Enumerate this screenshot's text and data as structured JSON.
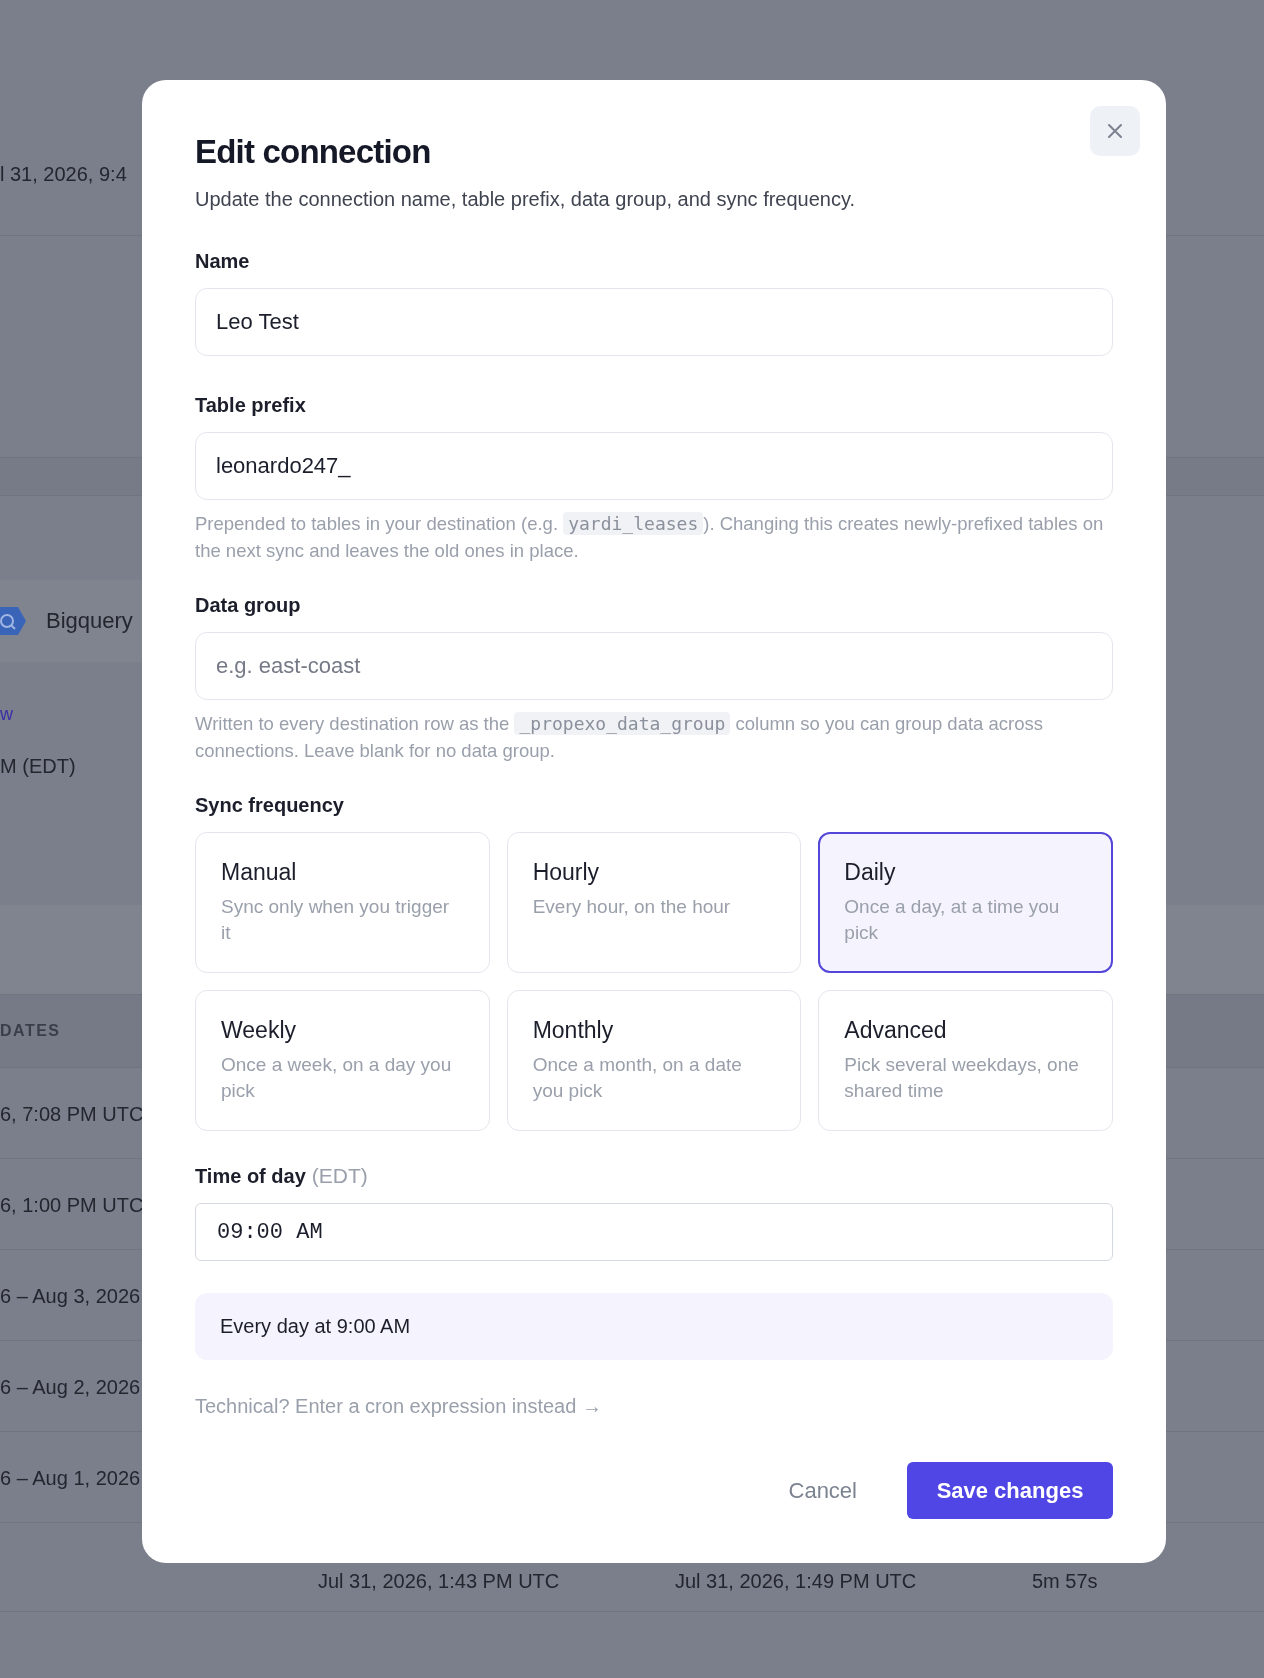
{
  "background": {
    "top_date": "l 31, 2026, 9:4",
    "destination": "Bigquery",
    "link_fragment": "w",
    "schedule_fragment": "M (EDT)",
    "table": {
      "column_header": "DATES",
      "rows": [
        "6, 7:08 PM UTC",
        "6, 1:00 PM UTC",
        "6 – Aug 3, 2026",
        "6 – Aug 2, 2026",
        "6 – Aug 1, 2026"
      ],
      "bottom_row": [
        "Jul 31, 2026, 1:43 PM UTC",
        "Jul 31, 2026, 1:49 PM UTC",
        "5m 57s"
      ]
    }
  },
  "dialog": {
    "title": "Edit connection",
    "subtitle": "Update the connection name, table prefix, data group, and sync frequency.",
    "fields": [
      {
        "label": "Name",
        "value": "Leo Test"
      },
      {
        "label": "Table prefix",
        "value": "leonardo247_",
        "help": {
          "before": "Prepended to tables in your destination (e.g. ",
          "code": "yardi_leases",
          "after": "). Changing this creates newly-prefixed tables on the next sync and leaves the old ones in place."
        }
      },
      {
        "label": "Data group",
        "placeholder": "e.g. east-coast",
        "help": {
          "before": "Written to every destination row as the ",
          "code": "_propexo_data_group",
          "after": " column so you can group data across connections. Leave blank for no data group."
        }
      }
    ],
    "sync_frequency": {
      "label": "Sync frequency",
      "options": [
        {
          "title": "Manual",
          "description": "Sync only when you trigger it",
          "selected": false
        },
        {
          "title": "Hourly",
          "description": "Every hour, on the hour",
          "selected": false
        },
        {
          "title": "Daily",
          "description": "Once a day, at a time you pick",
          "selected": true
        },
        {
          "title": "Weekly",
          "description": "Once a week, on a day you pick",
          "selected": false
        },
        {
          "title": "Monthly",
          "description": "Once a month, on a date you pick",
          "selected": false
        },
        {
          "title": "Advanced",
          "description": "Pick several weekdays, one shared time",
          "selected": false
        }
      ]
    },
    "time_of_day": {
      "label": "Time of day",
      "timezone": "(EDT)",
      "value": "09:00 AM"
    },
    "summary": "Every day at 9:00 AM",
    "cron_link": "Technical? Enter a cron expression instead →",
    "buttons": {
      "cancel": "Cancel",
      "save": "Save changes"
    }
  }
}
